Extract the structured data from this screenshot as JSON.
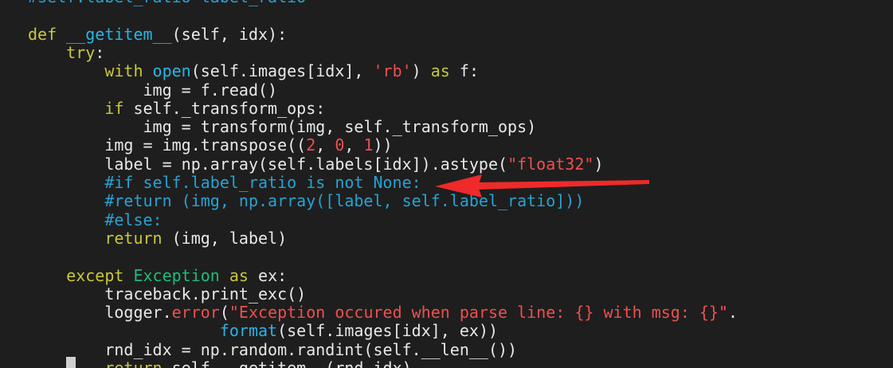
{
  "editor": {
    "lines": [
      {
        "tokens": [
          {
            "t": "#self.label_ratio=label_ratio",
            "c": "comment"
          }
        ]
      },
      {
        "tokens": []
      },
      {
        "tokens": [
          {
            "t": "def ",
            "c": "keyword"
          },
          {
            "t": "__getitem__",
            "c": "func"
          },
          {
            "t": "(self, idx):",
            "c": "plain"
          }
        ]
      },
      {
        "tokens": [
          {
            "t": "    "
          },
          {
            "t": "try",
            "c": "keyword"
          },
          {
            "t": ":",
            "c": "plain"
          }
        ]
      },
      {
        "tokens": [
          {
            "t": "        "
          },
          {
            "t": "with ",
            "c": "keyword"
          },
          {
            "t": "open",
            "c": "func"
          },
          {
            "t": "(self.images[idx], ",
            "c": "plain"
          },
          {
            "t": "'rb'",
            "c": "string"
          },
          {
            "t": ") ",
            "c": "plain"
          },
          {
            "t": "as",
            "c": "keyword"
          },
          {
            "t": " f:",
            "c": "plain"
          }
        ]
      },
      {
        "tokens": [
          {
            "t": "            "
          },
          {
            "t": "img = f.read()",
            "c": "plain"
          }
        ]
      },
      {
        "tokens": [
          {
            "t": "        "
          },
          {
            "t": "if",
            "c": "keyword"
          },
          {
            "t": " self._transform_ops:",
            "c": "plain"
          }
        ]
      },
      {
        "tokens": [
          {
            "t": "            "
          },
          {
            "t": "img = transform(img, self._transform_ops)",
            "c": "plain"
          }
        ]
      },
      {
        "tokens": [
          {
            "t": "        "
          },
          {
            "t": "img = img.transpose((",
            "c": "plain"
          },
          {
            "t": "2",
            "c": "number"
          },
          {
            "t": ", ",
            "c": "plain"
          },
          {
            "t": "0",
            "c": "number"
          },
          {
            "t": ", ",
            "c": "plain"
          },
          {
            "t": "1",
            "c": "number"
          },
          {
            "t": "))",
            "c": "plain"
          }
        ]
      },
      {
        "tokens": [
          {
            "t": "        "
          },
          {
            "t": "label = np.array(self.labels[idx]).astype(",
            "c": "plain"
          },
          {
            "t": "\"float32\"",
            "c": "string"
          },
          {
            "t": ")",
            "c": "plain"
          }
        ]
      },
      {
        "tokens": [
          {
            "t": "        "
          },
          {
            "t": "#if self.label_ratio is not None:",
            "c": "comment"
          }
        ]
      },
      {
        "tokens": [
          {
            "t": "        "
          },
          {
            "t": "#return (img, np.array([label, self.label_ratio]))",
            "c": "comment"
          }
        ]
      },
      {
        "tokens": [
          {
            "t": "        "
          },
          {
            "t": "#else:",
            "c": "comment"
          }
        ]
      },
      {
        "tokens": [
          {
            "t": "        "
          },
          {
            "t": "return",
            "c": "keyword"
          },
          {
            "t": " (img, label)",
            "c": "plain"
          }
        ]
      },
      {
        "tokens": []
      },
      {
        "tokens": [
          {
            "t": "    "
          },
          {
            "t": "except ",
            "c": "keyword"
          },
          {
            "t": "Exception",
            "c": "class"
          },
          {
            "t": " ",
            "c": "plain"
          },
          {
            "t": "as",
            "c": "keyword"
          },
          {
            "t": " ex:",
            "c": "plain"
          }
        ]
      },
      {
        "tokens": [
          {
            "t": "        "
          },
          {
            "t": "traceback.print_exc()",
            "c": "plain"
          }
        ]
      },
      {
        "tokens": [
          {
            "t": "        "
          },
          {
            "t": "logger.",
            "c": "plain"
          },
          {
            "t": "error",
            "c": "error"
          },
          {
            "t": "(",
            "c": "plain"
          },
          {
            "t": "\"Exception occured when parse line: {} with msg: {}\"",
            "c": "string"
          },
          {
            "t": ".",
            "c": "plain"
          }
        ]
      },
      {
        "tokens": [
          {
            "t": "                    "
          },
          {
            "t": "format",
            "c": "func"
          },
          {
            "t": "(self.images[idx], ex))",
            "c": "plain"
          }
        ]
      },
      {
        "tokens": [
          {
            "t": "        "
          },
          {
            "t": "rnd_idx = np.random.randint(self.__len__())",
            "c": "plain"
          }
        ]
      },
      {
        "tokens": [
          {
            "t": "        "
          },
          {
            "t": "return",
            "c": "keyword"
          },
          {
            "t": " self.__getitem__(rnd_idx)",
            "c": "plain"
          }
        ]
      }
    ]
  },
  "annotation": {
    "arrow_color": "#ee2a2a",
    "arrow_target": "comment-if-label-ratio-line"
  },
  "colors": {
    "background": "#1e1e1e",
    "plain": "#e8e8e8",
    "keyword": "#c8c83a",
    "function": "#27b5e6",
    "string": "#ee4f4f",
    "comment": "#27a2d2",
    "class": "#1dbb7a"
  }
}
